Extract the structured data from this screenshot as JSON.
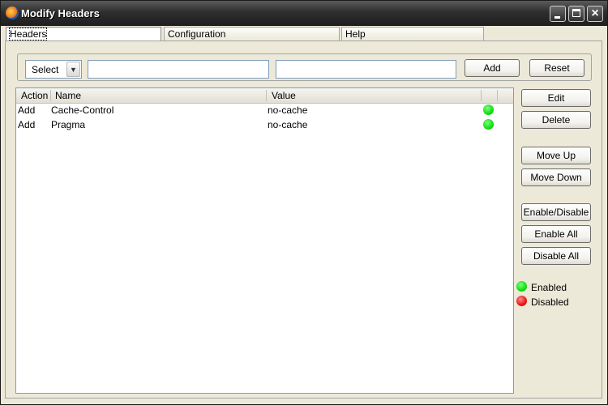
{
  "window": {
    "title": "Modify Headers",
    "controls": {
      "minimize": "minimize",
      "maximize": "maximize",
      "close": "×"
    }
  },
  "tabs": [
    {
      "label": "Headers",
      "active": true
    },
    {
      "label": "Configuration",
      "active": false
    },
    {
      "label": "Help",
      "active": false
    }
  ],
  "input_bar": {
    "action_select_value": "Select",
    "name_value": "",
    "value_value": "",
    "add_label": "Add",
    "reset_label": "Reset"
  },
  "table": {
    "columns": [
      "Action",
      "Name",
      "Value",
      ""
    ],
    "rows": [
      {
        "action": "Add",
        "name": "Cache-Control",
        "value": "no-cache",
        "status": "enabled"
      },
      {
        "action": "Add",
        "name": "Pragma",
        "value": "no-cache",
        "status": "enabled"
      }
    ]
  },
  "side_buttons": {
    "edit": "Edit",
    "delete": "Delete",
    "move_up": "Move Up",
    "move_down": "Move Down",
    "enable_disable": "Enable/Disable",
    "enable_all": "Enable All",
    "disable_all": "Disable All"
  },
  "legend": {
    "enabled": "Enabled",
    "disabled": "Disabled"
  },
  "colors": {
    "enabled": "#11dd11",
    "disabled": "#e81515",
    "titlebar": "#2e2e2e",
    "window_bg": "#ece9d8"
  }
}
